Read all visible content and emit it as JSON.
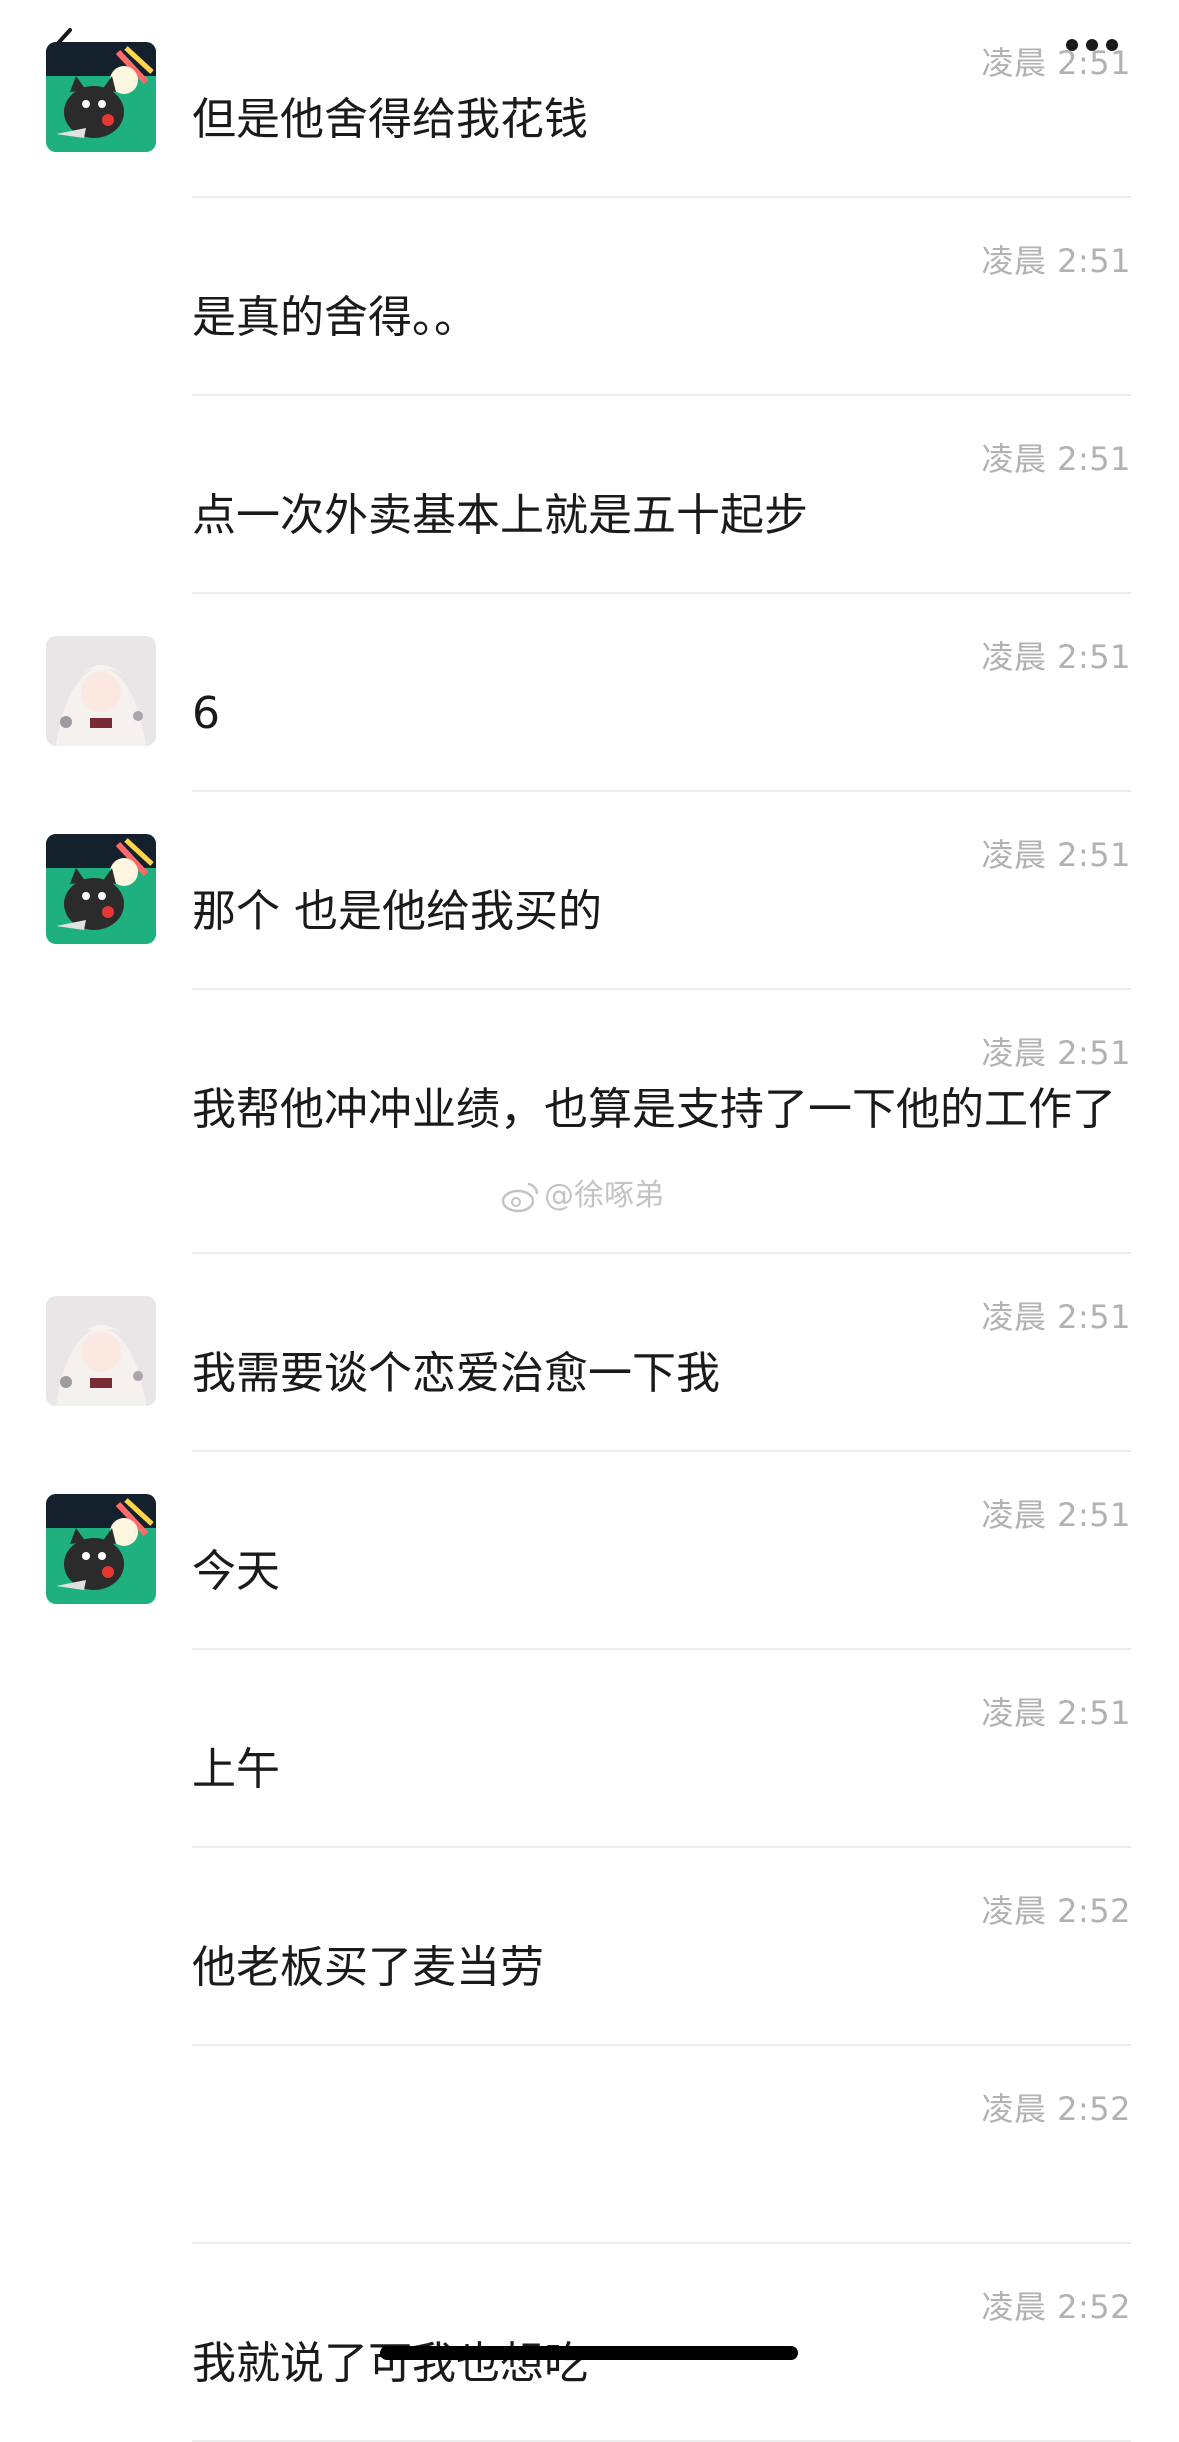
{
  "header": {
    "back_icon": "chevron-left-icon",
    "more_icon": "more-dots-icon"
  },
  "messages": [
    {
      "avatar": "cat",
      "time": "凌晨 2:51",
      "text": "但是他舍得给我花钱"
    },
    {
      "avatar": "",
      "time": "凌晨 2:51",
      "text": "是真的舍得。。"
    },
    {
      "avatar": "",
      "time": "凌晨 2:51",
      "text": "点一次外卖基本上就是五十起步"
    },
    {
      "avatar": "girl",
      "time": "凌晨 2:51",
      "text": "6"
    },
    {
      "avatar": "cat",
      "time": "凌晨 2:51",
      "text": "那个          也是他给我买的"
    },
    {
      "avatar": "",
      "time": "凌晨 2:51",
      "text": "我帮他冲冲业绩，也算是支持了一下他的工作了"
    },
    {
      "avatar": "girl",
      "time": "凌晨 2:51",
      "text": "我需要谈个恋爱治愈一下我"
    },
    {
      "avatar": "cat",
      "time": "凌晨 2:51",
      "text": "今天"
    },
    {
      "avatar": "",
      "time": "凌晨 2:51",
      "text": "上午"
    },
    {
      "avatar": "",
      "time": "凌晨 2:52",
      "text": "他老板买了麦当劳"
    },
    {
      "avatar": "",
      "time": "凌晨 2:52",
      "text": ""
    },
    {
      "avatar": "",
      "time": "凌晨 2:52",
      "text": "我就说了可我也想吃"
    }
  ],
  "watermark": "@徐啄弟",
  "colors": {
    "time": "#b2b2b2",
    "divider": "#ececec",
    "cat_avatar_bg": "#1fb07f"
  }
}
